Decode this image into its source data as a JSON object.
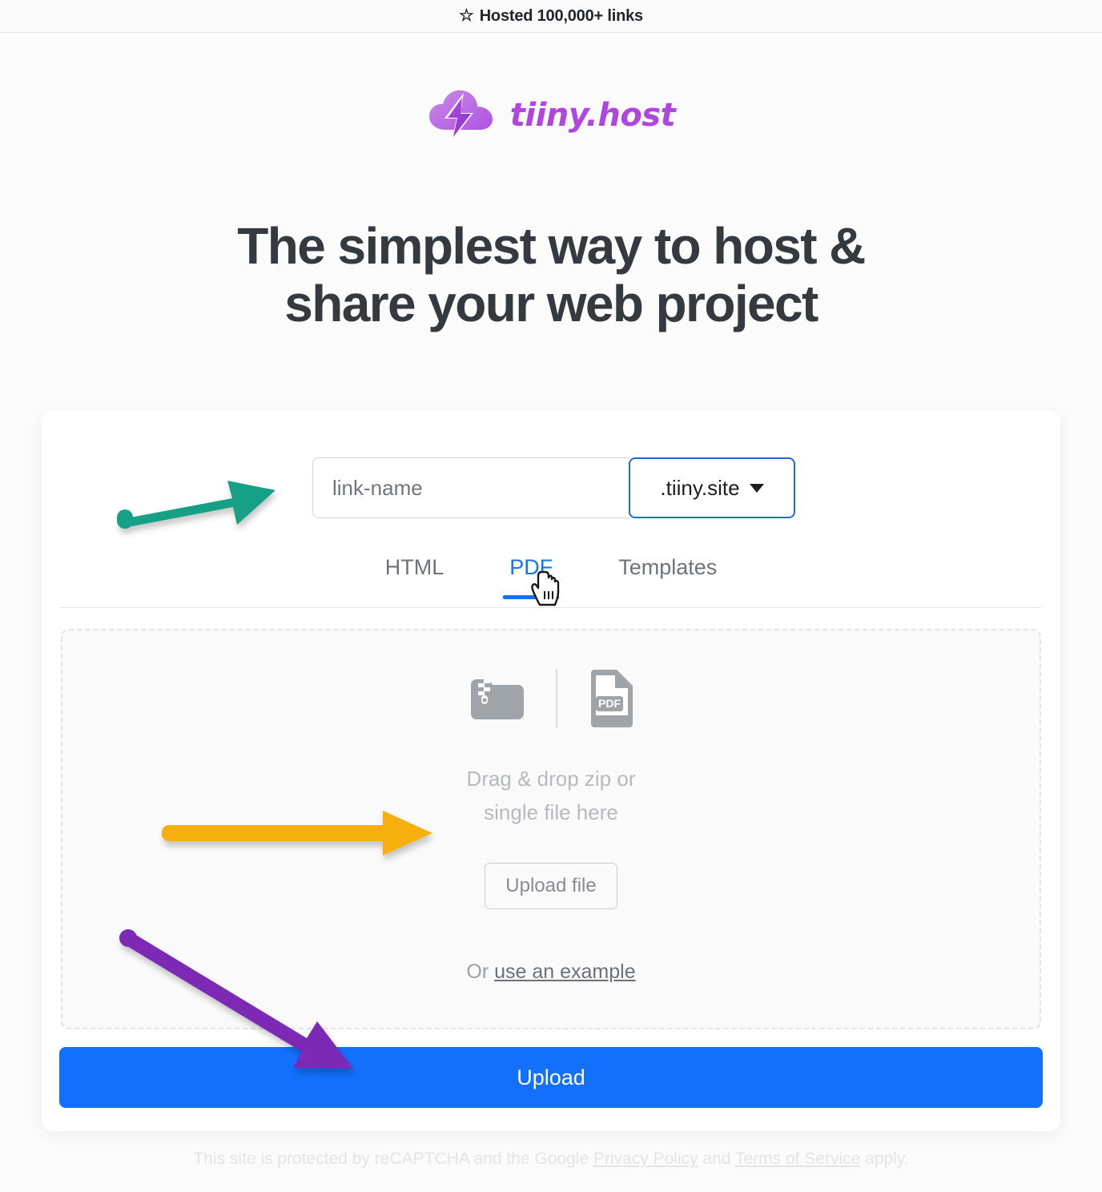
{
  "topbar": {
    "icon": "star-icon",
    "text": "Hosted 100,000+ links"
  },
  "brand": {
    "icon": "cloud-lightning-logo-icon",
    "name": "tiiny.host",
    "logo_color": "#b045e0"
  },
  "hero": {
    "line1": "The simplest way to host &",
    "line2": "share your web project"
  },
  "form": {
    "link_name_value": "",
    "link_name_placeholder": "link-name",
    "tld_selected": ".tiiny.site",
    "tld_caret_icon": "chevron-down-icon"
  },
  "tabs": [
    {
      "label": "HTML",
      "active": false
    },
    {
      "label": "PDF",
      "active": true
    },
    {
      "label": "Templates",
      "active": false
    }
  ],
  "dropzone": {
    "zip_icon": "zip-folder-icon",
    "pdf_icon": "pdf-file-icon",
    "text_line1": "Drag & drop zip or",
    "text_line2": "single file here",
    "upload_file_label": "Upload file",
    "example_prefix": "Or ",
    "example_link": "use an example"
  },
  "actions": {
    "upload_label": "Upload",
    "upload_color": "#1270fd"
  },
  "footer": {
    "prefix": "This site is protected by reCAPTCHA and the Google ",
    "privacy_link": "Privacy Policy",
    "middle": " and ",
    "terms_link": "Terms of Service",
    "suffix": " apply."
  },
  "annotations": [
    {
      "name": "teal-arrow",
      "color": "#14a085",
      "points_to": "link-name-input"
    },
    {
      "name": "orange-arrow",
      "color": "#f5b011",
      "points_to": "upload-file-button"
    },
    {
      "name": "purple-arrow",
      "color": "#7b2cb5",
      "points_to": "upload-button"
    }
  ],
  "cursor": {
    "icon": "pointing-hand-cursor-icon",
    "over": "tab-pdf"
  }
}
